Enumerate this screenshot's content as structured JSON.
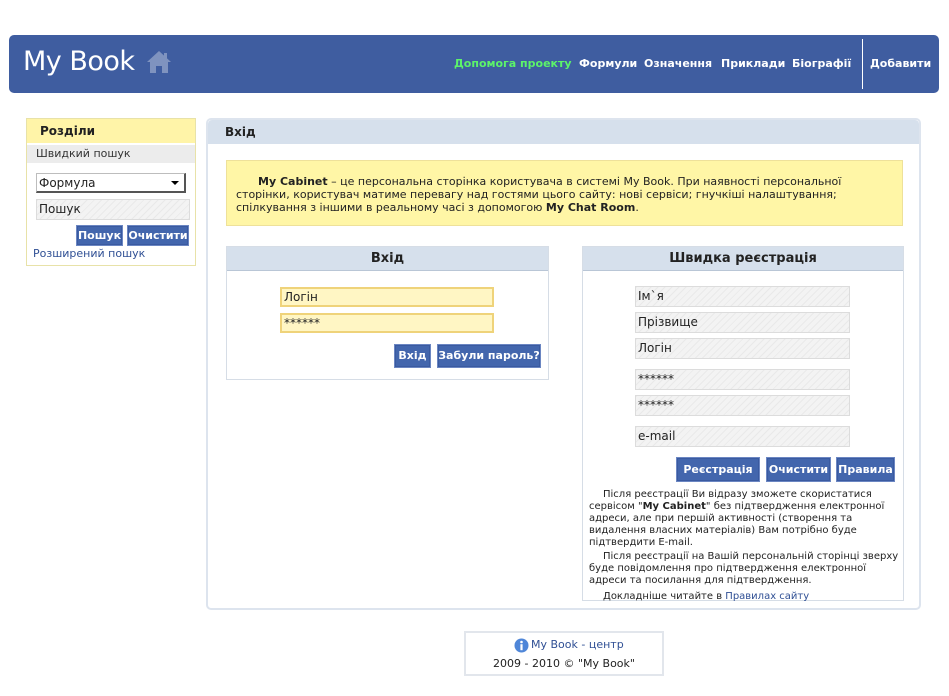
{
  "header": {
    "logo": "My Book",
    "nav": [
      "Допомога проекту",
      "Формули",
      "Означення",
      "Приклади",
      "Біографії"
    ],
    "add_label": "Добавити",
    "colors": {
      "bar": "#3f5da0",
      "help_link": "#5cf36a"
    }
  },
  "sidebar": {
    "title": "Розділи",
    "subtitle": "Швидкий пошук",
    "select_value": "Формула",
    "search_placeholder": "Пошук",
    "search_button": "Пошук",
    "clear_button": "Очистити",
    "advanced_link": "Розширений пошук"
  },
  "main": {
    "title": "Вхід",
    "notice": {
      "brand": "My Cabinet",
      "text1": " – це персональна сторінка користувача в системі My Book. При наявності персональної сторінки, користувач матиме перевагу над гостями цього сайту: нові сервіси; гнучкіші налаштування; спілкування з іншими в реальному часі з допомогою ",
      "chat": "My Chat Room",
      "text2": "."
    },
    "login": {
      "title": "Вхід",
      "login_value": "Логін",
      "password_value": "******",
      "submit": "Вхід",
      "forgot": "Забули пароль?"
    },
    "register": {
      "title": "Швидка реєстрація",
      "name": "Ім`я",
      "surname": "Прізвище",
      "login": "Логін",
      "password": "******",
      "password_repeat": "******",
      "email": "e-mail",
      "submit": "Реєстрація",
      "clear": "Очистити",
      "rules": "Правила",
      "note1_a": "Після реєстрації Ви відразу зможете скористатися сервісом \"",
      "note1_brand": "My Cabinet",
      "note1_b": "\" без підтвердження електронної адреси, але при першій активності (створення та видалення власних матеріалів) Вам потрібно буде підтвердити E-mail.",
      "note2": "Після реєстрації на Вашій персональній сторінці зверху буде повідомлення про підтвердження електронної адреси та посилання для підтвердження.",
      "note3_a": "Докладніше читайте в ",
      "note3_link": "Правилах сайту"
    }
  },
  "footer": {
    "link": "My Book - центр",
    "copyright": "2009 - 2010 © \"My Book\""
  }
}
